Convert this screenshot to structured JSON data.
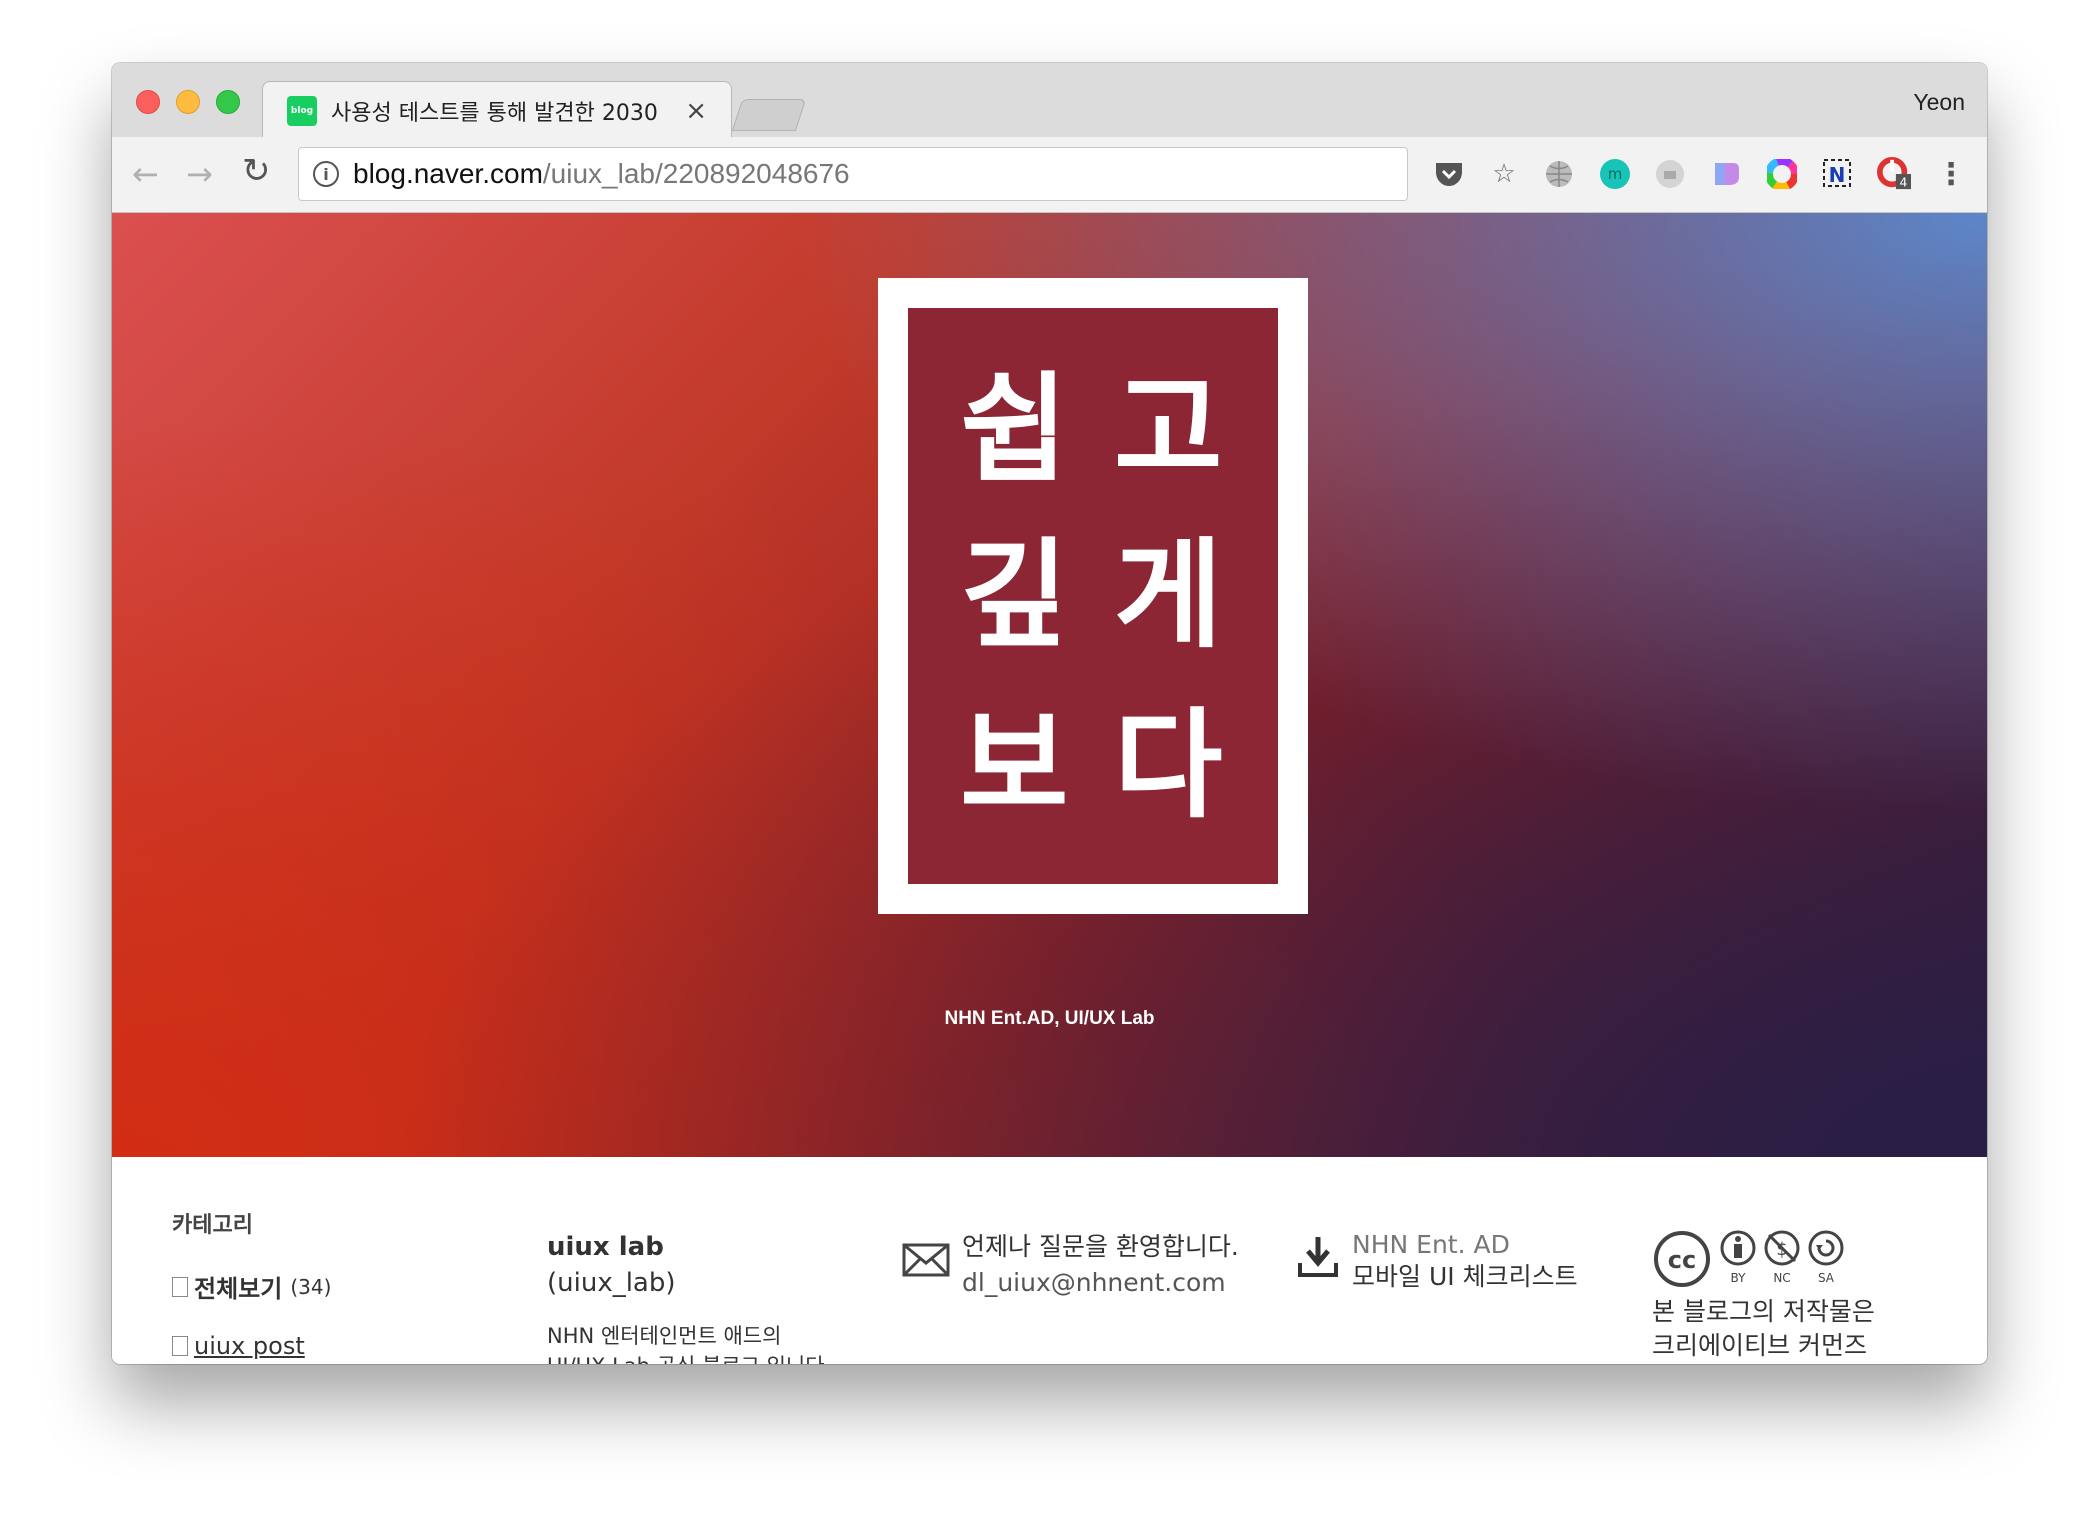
{
  "browser": {
    "tab_title": "사용성 테스트를 통해 발견한 2030",
    "favicon_text": "blog",
    "tab_close": "×",
    "profile_name": "Yeon",
    "url_host": "blog.naver.com",
    "url_path": "/uiux_lab/220892048676",
    "extension_badge": "4"
  },
  "hero": {
    "poster_glyphs": [
      "쉽",
      "고",
      "깊",
      "게",
      "보",
      "다"
    ],
    "credit": "NHN Ent.AD, UI/UX Lab"
  },
  "footer": {
    "category_title": "카테고리",
    "categories": [
      {
        "label": "전체보기",
        "count": "(34)"
      },
      {
        "label": "uiux post"
      }
    ],
    "blog_name": "uiux lab",
    "blog_id": "(uiux_lab)",
    "blog_desc_1": "NHN 엔터테인먼트 애드의",
    "blog_desc_2": "UI/UX Lab 공식 블로그 입니다",
    "contact_line1": "언제나 질문을 환영합니다.",
    "contact_email": "dl_uiux@nhnent.com",
    "download_line1": "NHN Ent. AD",
    "download_line2": "모바일 UI 체크리스트",
    "license_line1": "본 블로그의 저작물은",
    "license_line2": "크리에이티브 커먼즈",
    "cc_labels": [
      "BY",
      "NC",
      "SA"
    ]
  },
  "colors": {
    "poster_bg": "#8c2534",
    "favicon": "#19ce60"
  }
}
